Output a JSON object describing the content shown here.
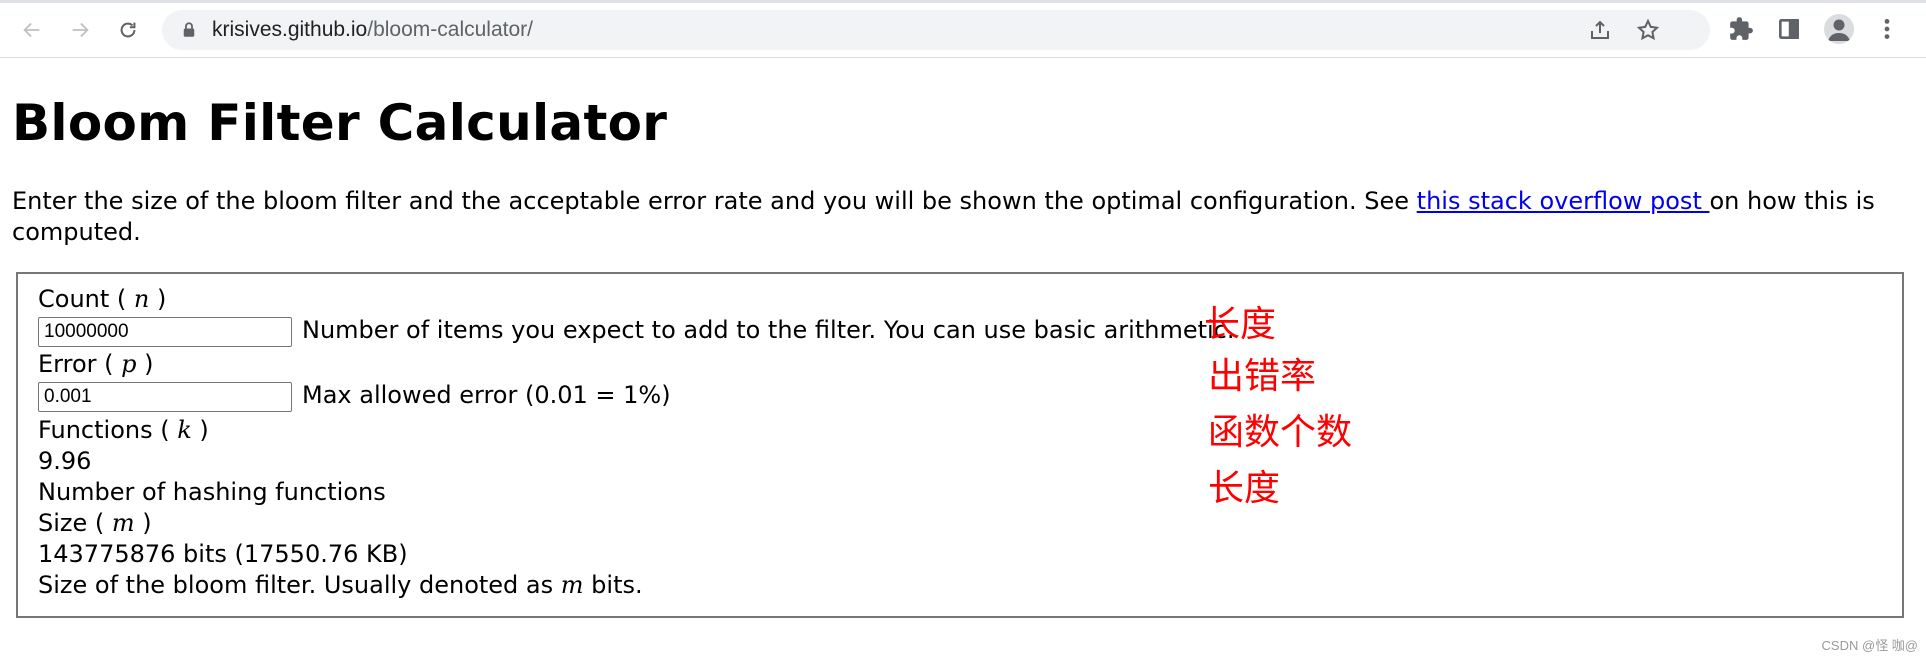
{
  "browser": {
    "url_host": "krisives.github.io",
    "url_path": "/bloom-calculator/",
    "icons": [
      "back-icon",
      "forward-icon",
      "reload-icon",
      "lock-icon",
      "share-icon",
      "star-icon",
      "extensions-icon",
      "sidepanel-icon",
      "profile-icon",
      "menu-icon"
    ]
  },
  "page": {
    "title": "Bloom Filter Calculator",
    "intro_before": "Enter the size of the bloom filter and the acceptable error rate and you will be shown the optimal configuration. See ",
    "intro_link": "this stack overflow post ",
    "intro_after": "on how this is computed."
  },
  "calculator": {
    "count": {
      "label_prefix": "Count ( ",
      "symbol": "n",
      "label_suffix": " )",
      "value": "10000000",
      "help": "Number of items you expect to add to the filter. You can use basic arithmetic."
    },
    "error": {
      "label_prefix": "Error ( ",
      "symbol": "p",
      "label_suffix": " )",
      "value": "0.001",
      "help": "Max allowed error (0.01 = 1%)"
    },
    "functions": {
      "label_prefix": "Functions ( ",
      "symbol": "k",
      "label_suffix": " )",
      "value": "9.96",
      "help": "Number of hashing functions"
    },
    "size": {
      "label_prefix": "Size ( ",
      "symbol": "m",
      "label_suffix": " )",
      "value": "143775876 bits (17550.76 KB)",
      "help_before": "Size of the bloom filter. Usually denoted as ",
      "help_symbol": "m",
      "help_after": " bits."
    }
  },
  "annotations": {
    "note_1": "长度",
    "note_2": "出错率",
    "note_3": "函数个数",
    "note_4": "长度",
    "color": "#ff0000"
  },
  "watermark": "CSDN @怪 咖@"
}
